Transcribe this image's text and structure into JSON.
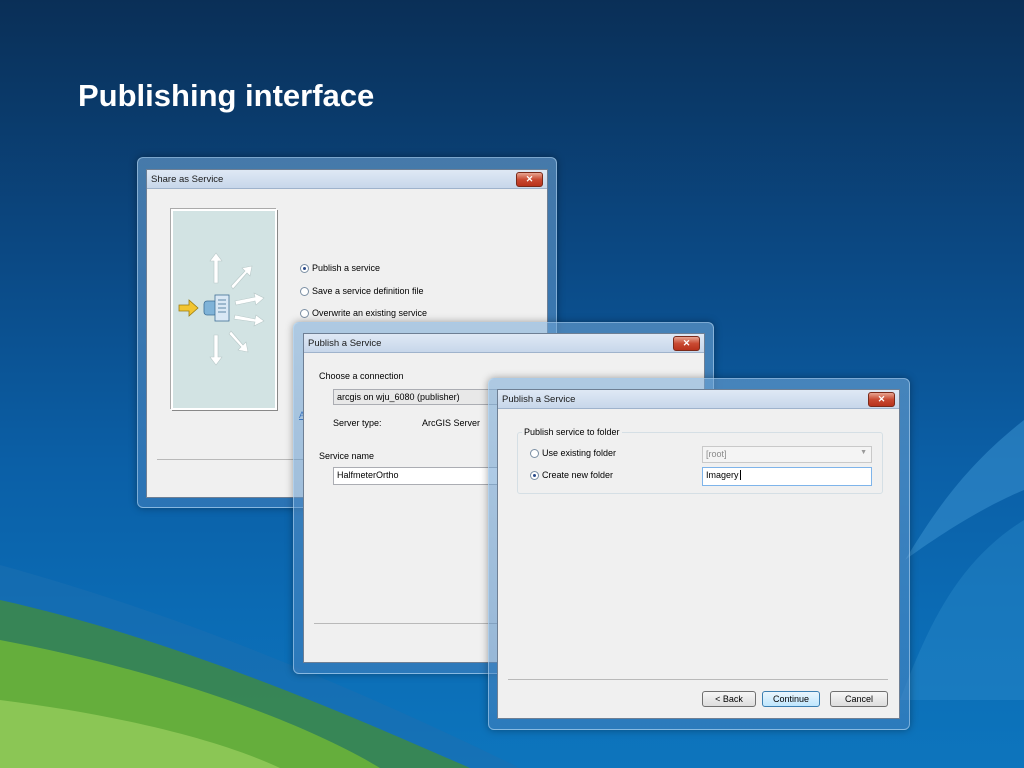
{
  "slide": {
    "title": "Publishing interface"
  },
  "dialog_share": {
    "title": "Share as Service",
    "close_glyph": "✕",
    "options": [
      {
        "label": "Publish a service",
        "selected": true
      },
      {
        "label": "Save a service definition file",
        "selected": false
      },
      {
        "label": "Overwrite an existing service",
        "selected": false
      }
    ],
    "link_fragment": "A"
  },
  "dialog_publish1": {
    "title": "Publish a Service",
    "close_glyph": "✕",
    "choose_connection_label": "Choose a connection",
    "connection_value": "arcgis on wju_6080 (publisher)",
    "server_type_label": "Server type:",
    "server_type_value": "ArcGIS Server",
    "service_name_label": "Service name",
    "service_name_value": "HalfmeterOrtho"
  },
  "dialog_publish2": {
    "title": "Publish a Service",
    "close_glyph": "✕",
    "group_label": "Publish service to folder",
    "use_existing_label": "Use existing folder",
    "use_existing_selected": false,
    "existing_folder_value": "[root]",
    "create_new_label": "Create new folder",
    "create_new_selected": true,
    "new_folder_value": "Imagery",
    "back_label": "< Back",
    "continue_label": "Continue",
    "cancel_label": "Cancel"
  },
  "icons": [
    "close-icon",
    "publish-arrow-icon",
    "server-icon",
    "dropdown-arrow-icon"
  ]
}
